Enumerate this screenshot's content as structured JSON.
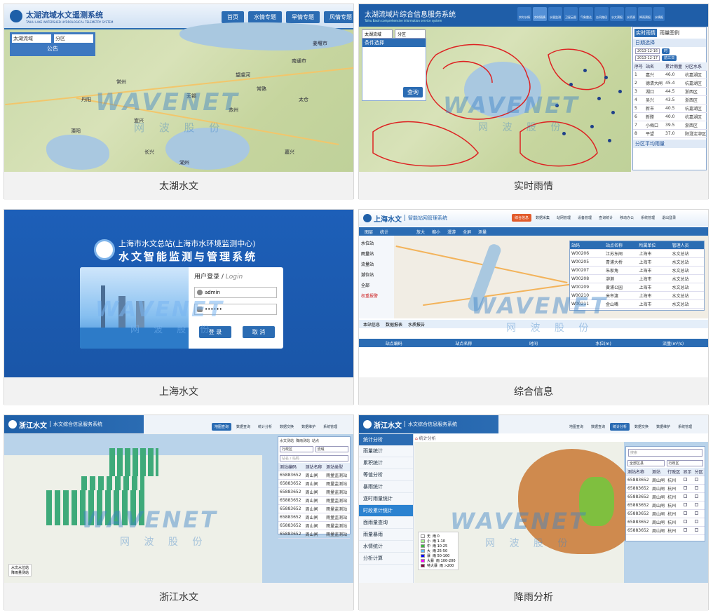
{
  "cards": [
    {
      "caption": "太湖水文",
      "system_title": "太湖流域水文遥测系统",
      "system_subtitle": "TAIHU LAKE WATERSHED HYDROLOGICAL TELEMETRY SYSTEM",
      "tabs": [
        "首页",
        "水情专题",
        "旱情专题",
        "风情专题"
      ],
      "selects": [
        "太湖流域",
        "分区"
      ],
      "panel_title": "公告",
      "map_labels": [
        "南通市",
        "姜堰市",
        "常熟",
        "长兴",
        "湖州",
        "苏州",
        "太仓",
        "望虞河",
        "无锡",
        "常州",
        "宜兴",
        "嘉兴",
        "丹阳",
        "溧阳"
      ]
    },
    {
      "caption": "实时雨情",
      "system_title": "太湖流域片综合信息服务系统",
      "system_subtitle": "Taihu Basin comprehensive information service system",
      "tabs": [
        "实时水情",
        "实时雨情",
        "水量监测",
        "卫星云图",
        "气象雷达",
        "台风路径",
        "水文预报",
        "水资源",
        "降雨预报",
        "水情报"
      ],
      "selects": [
        "太湖流域",
        "分区"
      ],
      "query_title": "条件选择",
      "query_button": "查询",
      "right_tabs": [
        "实时雨情",
        "雨量图例",
        "雨量级别"
      ],
      "date_label": "日期选择",
      "dates": [
        "2013-12-16",
        "2013-12-17"
      ],
      "date_buttons": [
        "时",
        "前三日"
      ],
      "table_headers": [
        "序号",
        "站名",
        "累计雨量",
        "分区水系"
      ],
      "table_rows": [
        [
          "1",
          "嘉兴",
          "46.0",
          "杭嘉湖区"
        ],
        [
          "2",
          "德清大闸",
          "45.4",
          "杭嘉湖区"
        ],
        [
          "3",
          "湖口",
          "44.5",
          "浙西区"
        ],
        [
          "4",
          "吴兴",
          "43.5",
          "浙西区"
        ],
        [
          "5",
          "新市",
          "40.5",
          "杭嘉湖区"
        ],
        [
          "6",
          "新塍",
          "40.0",
          "杭嘉湖区"
        ],
        [
          "7",
          "小梅口",
          "39.5",
          "浙西区"
        ],
        [
          "8",
          "平望",
          "37.0",
          "阳澄淀泖区"
        ]
      ],
      "footer": "分区平均雨量"
    },
    {
      "caption": "上海水文",
      "title_line1": "上海市水文总站(上海市水环境监测中心)",
      "title_line2": "水文智能监测与管理系统",
      "login_title": "用户登录",
      "login_sub": "Login",
      "username": "admin",
      "password": "••••••",
      "login_button": "登 录",
      "cancel_button": "取 消"
    },
    {
      "caption": "综合信息",
      "system_title": "上海水文",
      "system_subtitle": "智能站网管理系统",
      "tabs": [
        "综合信息",
        "数据采集",
        "站网管理",
        "设备管理",
        "查询统计",
        "移动办公",
        "系统管理",
        "退出登录"
      ],
      "left_tabs": [
        "图层",
        "统计"
      ],
      "toolbar": [
        "放大",
        "缩小",
        "漫游",
        "全屏",
        "测量"
      ],
      "layers": [
        "水位站",
        "雨量站",
        "流量站",
        "潮位站",
        "全部",
        "权重报警"
      ],
      "table_headers": [
        "站码",
        "站点名称",
        "所属单位",
        "管理人员"
      ],
      "table_rows": [
        [
          "W00206",
          "江苏东闸",
          "上海市",
          "水文总站"
        ],
        [
          "W00205",
          "青浦大桥",
          "上海市",
          "水文总站"
        ],
        [
          "W00207",
          "朱家角",
          "上海市",
          "水文总站"
        ],
        [
          "W00208",
          "泖港",
          "上海市",
          "水文总站"
        ],
        [
          "W00209",
          "黄浦公园",
          "上海市",
          "水文总站"
        ],
        [
          "W00210",
          "米市渡",
          "上海市",
          "水文总站"
        ],
        [
          "W00211",
          "金山嘴",
          "上海市",
          "水文总站"
        ]
      ],
      "bottom_tabs": [
        "本站信息",
        "数据报表",
        "水质报告"
      ],
      "bottom_headers": [
        "站点编码",
        "站点名称",
        "时间",
        "水位(m)",
        "流量(m³/s)"
      ]
    },
    {
      "caption": "浙江水文",
      "system_title": "浙江水文",
      "system_subtitle": "水文综合信息服务系统",
      "tabs": [
        "地图查询",
        "数据查询",
        "统计分析",
        "数据交换",
        "数据维护",
        "系统管理"
      ],
      "checks": [
        "水文测站",
        "降雨测站",
        "站点"
      ],
      "selects": [
        "行政区",
        "流域"
      ],
      "search_placeholder": "站名 / 站码",
      "table_headers": [
        "测站编码",
        "测站名称",
        "测站类型"
      ],
      "table_rows": [
        [
          "65883652",
          "周山闸",
          "雨量监测站"
        ],
        [
          "65883652",
          "周山闸",
          "雨量监测站"
        ],
        [
          "65883652",
          "周山闸",
          "雨量监测站"
        ],
        [
          "65883652",
          "周山闸",
          "雨量监测站"
        ],
        [
          "65883652",
          "周山闸",
          "雨量监测站"
        ],
        [
          "65883652",
          "周山闸",
          "雨量监测站"
        ],
        [
          "65883652",
          "周山闸",
          "雨量监测站"
        ],
        [
          "65883652",
          "周山闸",
          "雨量监测站"
        ]
      ],
      "legend": [
        "水文水位站",
        "降雨量测站"
      ]
    },
    {
      "caption": "降雨分析",
      "system_title": "浙江水文",
      "system_subtitle": "水文综合信息服务系统",
      "tabs": [
        "地图查询",
        "数据查询",
        "统计分析",
        "数据交换",
        "数据维护",
        "系统管理"
      ],
      "side_title": "统计分析",
      "side_items": [
        "雨量统计",
        "累积统计",
        "等值分析",
        "暴雨统计",
        "逐时雨量统计",
        "时段累计统计",
        "面雨量查询",
        "雨量暴雨",
        "水情统计",
        "分析计算"
      ],
      "side_highlight": 5,
      "crumb": "统计分析",
      "search_placeholder": "搜索",
      "selects": [
        "全部区县",
        "行政区"
      ],
      "table_headers": [
        "测站名称",
        "测站",
        "行政区",
        "显示",
        "分区"
      ],
      "table_rows": [
        [
          "65883652",
          "周山闸",
          "杭州"
        ],
        [
          "65883652",
          "周山闸",
          "杭州"
        ],
        [
          "65883652",
          "周山闸",
          "杭州"
        ],
        [
          "65883652",
          "周山闸",
          "杭州"
        ],
        [
          "65883652",
          "周山闸",
          "杭州"
        ],
        [
          "65883652",
          "周山闸",
          "杭州"
        ],
        [
          "65883652",
          "周山闸",
          "杭州"
        ]
      ],
      "legend": [
        {
          "k": "无",
          "v": "雨 0",
          "c": "#ffffff"
        },
        {
          "k": "小",
          "v": "雨 1-10",
          "c": "#a6f28f"
        },
        {
          "k": "中",
          "v": "雨 10-25",
          "c": "#3db83d"
        },
        {
          "k": "大",
          "v": "雨 25-50",
          "c": "#61b8ff"
        },
        {
          "k": "暴",
          "v": "雨 50-100",
          "c": "#0000fe"
        },
        {
          "k": "大暴",
          "v": "雨 100-200",
          "c": "#fa00fa"
        },
        {
          "k": "特大暴",
          "v": "雨 >200",
          "c": "#800040"
        }
      ]
    }
  ],
  "watermark": {
    "en": "WAVENET",
    "cn": "网 波 股 份"
  },
  "colors": {
    "brand": "#1e5fa8",
    "map_green": "#c9d9a8",
    "water": "#a9c8e0",
    "rain_orange": "#cf8a4e",
    "rain_green": "#7fbf3f"
  }
}
